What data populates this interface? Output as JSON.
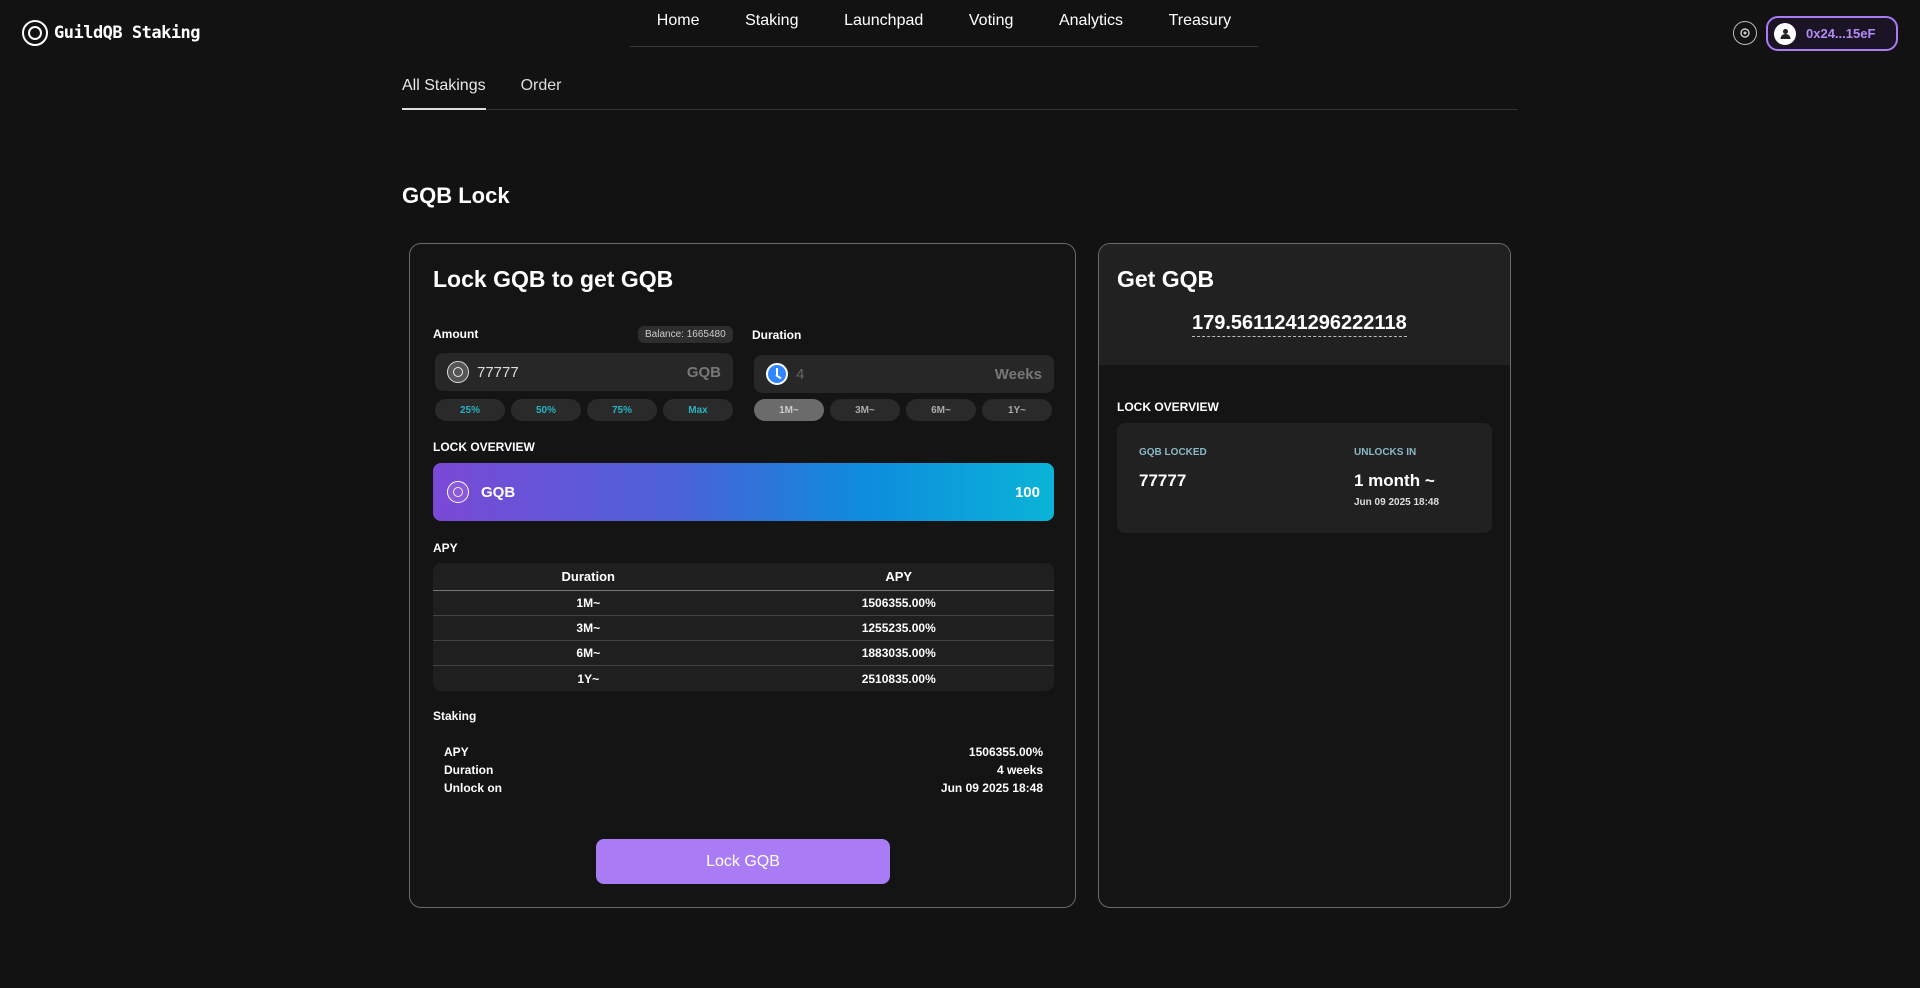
{
  "header": {
    "logo_text": "GuildQB Staking",
    "nav": [
      "Home",
      "Staking",
      "Launchpad",
      "Voting",
      "Analytics",
      "Treasury"
    ],
    "wallet_address": "0x24...15eF"
  },
  "subtabs": [
    "All Stakings",
    "Order"
  ],
  "page_title": "GQB Lock",
  "lock_card": {
    "title": "Lock GQB to get GQB",
    "amount_label": "Amount",
    "balance": "Balance: 1665480",
    "amount_value": "77777",
    "amount_unit": "GQB",
    "duration_label": "Duration",
    "duration_value": "4",
    "duration_unit": "Weeks",
    "pct_chips": [
      "25%",
      "50%",
      "75%",
      "Max"
    ],
    "duration_chips": [
      "1M~",
      "3M~",
      "6M~",
      "1Y~"
    ],
    "overview_label": "LOCK OVERVIEW",
    "overview_token": "GQB",
    "overview_value": "100",
    "apy_label": "APY",
    "apy_table": {
      "headers": [
        "Duration",
        "APY"
      ],
      "rows": [
        [
          "1M~",
          "1506355.00%"
        ],
        [
          "3M~",
          "1255235.00%"
        ],
        [
          "6M~",
          "1883035.00%"
        ],
        [
          "1Y~",
          "2510835.00%"
        ]
      ]
    },
    "staking_label": "Staking",
    "staking": {
      "apy_label": "APY",
      "apy_value": "1506355.00%",
      "duration_label": "Duration",
      "duration_value": "4 weeks",
      "unlock_label": "Unlock on",
      "unlock_value": "Jun 09 2025 18:48"
    },
    "lock_button": "Lock GQB"
  },
  "get_card": {
    "title": "Get GQB",
    "value": "179.5611241296222118",
    "overview_label": "LOCK OVERVIEW",
    "locked_label": "GQB LOCKED",
    "locked_value": "77777",
    "unlocks_label": "UNLOCKS IN",
    "unlocks_value": "1 month ~",
    "unlocks_date": "Jun 09 2025 18:48"
  },
  "colors": {
    "accent": "#a97cf5",
    "chip_text": "#25b3c4",
    "background": "#121212"
  }
}
